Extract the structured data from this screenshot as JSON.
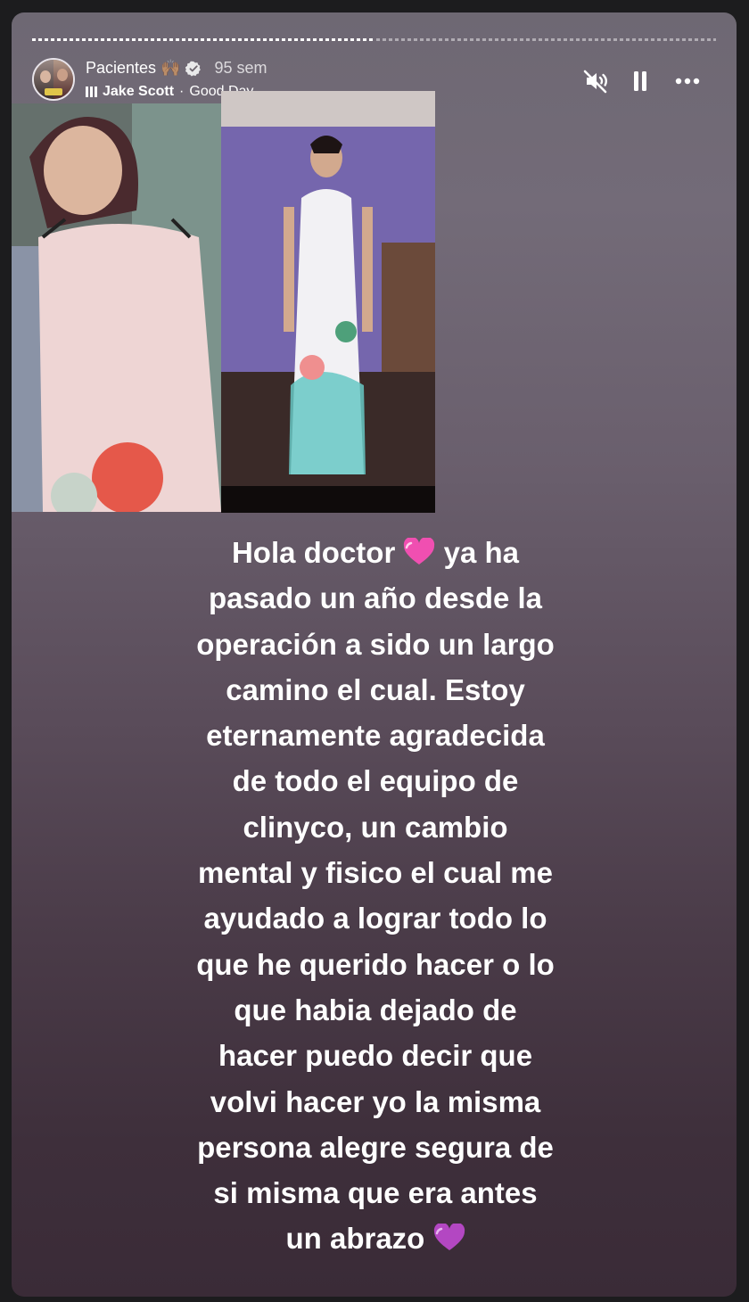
{
  "story": {
    "account_name": "Pacientes 🙌🏽",
    "timestamp": "95 sem",
    "music": {
      "artist": "Jake Scott",
      "separator": "·",
      "song": "Good Day"
    },
    "progress": [
      {
        "segment": 1,
        "fraction": 1.0
      },
      {
        "segment": 2,
        "fraction": 0.0
      }
    ],
    "controls": {
      "mute_icon": "speaker-muted-icon",
      "pause_icon": "pause-icon",
      "more_icon": "more-options-icon"
    },
    "message_lines": [
      "Hola doctor",
      "pasado un año desde la",
      "operación a sido un largo",
      "camino el cual. Estoy",
      "eternamente agradecida",
      "de todo el equipo de",
      "clinyco,  un cambio",
      "mental y fisico el cual me",
      "ayudado a lograr todo lo",
      "que he querido hacer o lo",
      "que habia dejado de",
      "hacer puedo decir que",
      "volvi hacer yo la misma",
      "persona alegre segura de",
      "si misma que era antes",
      "un abrazo"
    ],
    "message_line1_tail": "ya ha",
    "colors": {
      "heart_pink": "#f04fb1",
      "heart_purple": "#b347c2"
    }
  }
}
